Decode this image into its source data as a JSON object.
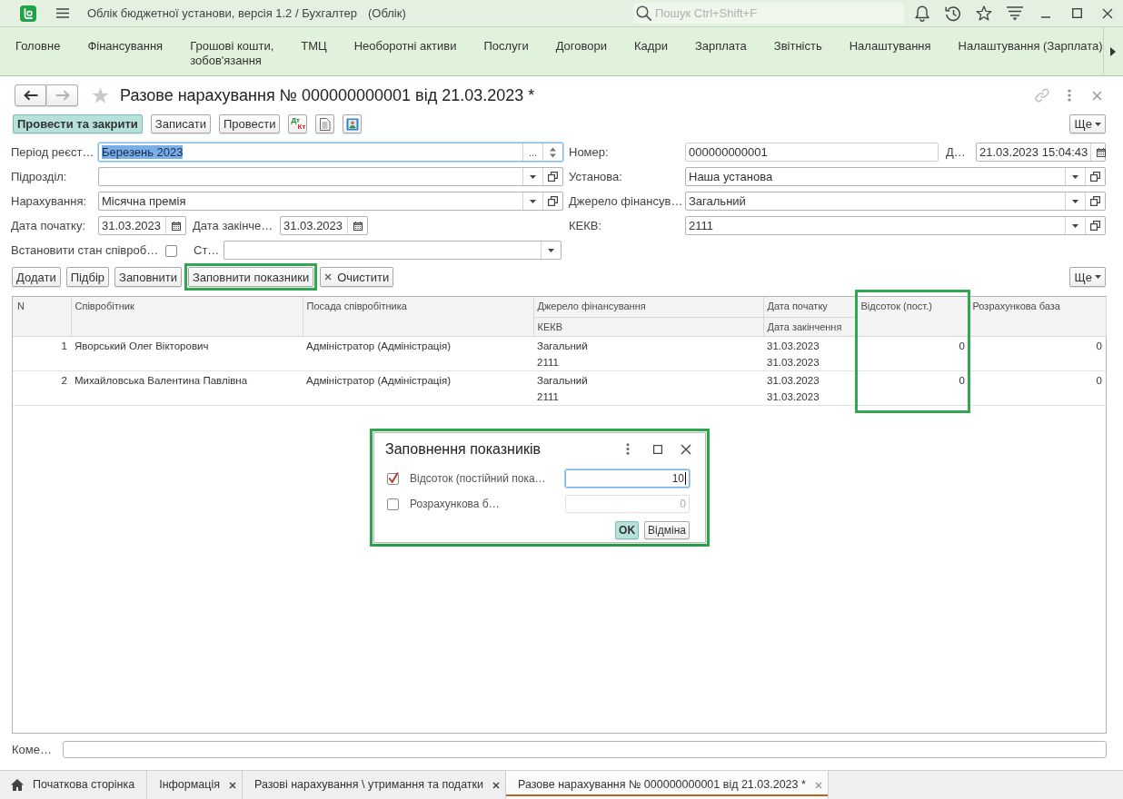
{
  "app_bar": {
    "title": "Облік бюджетної установи, версія 1.2 / Бухгалтер",
    "mode": "(Облік)",
    "search": {
      "placeholder": "Пошук Ctrl+Shift+F"
    }
  },
  "sections": [
    "Головне",
    "Фінансування",
    "Грошові кошти,\nзобов'язання",
    "ТМЦ",
    "Необоротні активи",
    "Послуги",
    "Договори",
    "Кадри",
    "Зарплата",
    "Звітність",
    "Налаштування",
    "Налаштування (Зарплата)"
  ],
  "document": {
    "navigation": [
      {
        "kind": "back",
        "disabled": false
      },
      {
        "kind": "forward",
        "disabled": true
      }
    ],
    "favorite": false,
    "title": "Разове нарахування № 000000000001 від 21.03.2023 *",
    "toolbar": [
      {
        "kind": "primary",
        "label": "Провести та закрити"
      },
      {
        "kind": "text",
        "label": "Записати"
      },
      {
        "kind": "text",
        "label": "Провести"
      },
      {
        "kind": "dtkt",
        "label": "Дт",
        "label_2": "Кт"
      },
      {
        "kind": "document"
      },
      {
        "kind": "report"
      }
    ],
    "more_label": "Ще",
    "left_fields": [
      {
        "kind": "period",
        "label": "Період реєст…",
        "value": "Березень 2023",
        "focused": true,
        "text_selected": true,
        "choice_button": "..."
      },
      {
        "kind": "select",
        "label": "Підрозділ:"
      },
      {
        "kind": "select",
        "label": "Нарахування:",
        "value": "Місячна премія"
      },
      {
        "kind": "date_pair",
        "label": "Дата початку:",
        "value": "31.03.2023",
        "label_2": "Дата закінче…",
        "value_2": "31.03.2023"
      },
      {
        "kind": "check_select",
        "label": "Встановити стан співроб…",
        "checked": false,
        "label_2": "Ст…"
      }
    ],
    "right_fields": [
      {
        "kind": "number_date",
        "label": "Номер:",
        "value": "000000000001",
        "label_2": "Д…",
        "value_2": "21.03.2023 15:04:43"
      },
      {
        "kind": "select",
        "label": "Установа:",
        "value": "Наша установа"
      },
      {
        "kind": "select",
        "label": "Джерело фінансув…",
        "value": "Загальний"
      },
      {
        "kind": "select",
        "label": "КЕКВ:",
        "value": "2111"
      }
    ],
    "table_toolbar": [
      {
        "kind": "text",
        "label": "Додати",
        "highlighted": false
      },
      {
        "kind": "text",
        "label": "Підбір",
        "highlighted": false
      },
      {
        "kind": "text",
        "label": "Заповнити",
        "highlighted": false
      },
      {
        "kind": "text",
        "label": "Заповнити показники",
        "highlighted": true
      },
      {
        "kind": "clear",
        "label": "Очистити",
        "highlighted": false
      }
    ],
    "table_more_label": "Ще",
    "table": {
      "columns": [
        {
          "label": "N",
          "kind": "number",
          "highlighted": false
        },
        {
          "label": "Співробітник",
          "kind": "text",
          "highlighted": false
        },
        {
          "label": "Посада співробітника",
          "kind": "text",
          "highlighted": false
        },
        {
          "label": "Джерело фінансування",
          "sublabel": "КЕКВ",
          "kind": "text",
          "highlighted": false
        },
        {
          "label": "Дата початку",
          "sublabel": "Дата закінчення",
          "kind": "text",
          "highlighted": false
        },
        {
          "label": "Відсоток (пост.)",
          "kind": "number",
          "highlighted": true
        },
        {
          "label": "Розрахункова база",
          "kind": "number",
          "highlighted": false
        }
      ],
      "rows": [
        {
          "cells": [
            [
              "1"
            ],
            [
              "Яворський Олег Вікторович"
            ],
            [
              "Адміністратор (Адміністрація)"
            ],
            [
              "Загальний",
              "2111"
            ],
            [
              "31.03.2023",
              "31.03.2023"
            ],
            [
              "0"
            ],
            [
              "0"
            ]
          ]
        },
        {
          "cells": [
            [
              "2"
            ],
            [
              "Михайловська Валентина Павлівна"
            ],
            [
              "Адміністратор (Адміністрація)"
            ],
            [
              "Загальний",
              "2111"
            ],
            [
              "31.03.2023",
              "31.03.2023"
            ],
            [
              "0"
            ],
            [
              "0"
            ]
          ]
        }
      ]
    },
    "comment": {
      "label": "Коме…"
    }
  },
  "dialog": {
    "title": "Заповнення показників",
    "highlighted": true,
    "rows": [
      {
        "label": "Відсоток (постійний пока…",
        "checked": true,
        "value": "10",
        "focused": true,
        "disabled": false
      },
      {
        "label": "Розрахункова б…",
        "checked": false,
        "value": "0",
        "focused": false,
        "disabled": true
      }
    ],
    "buttons": [
      {
        "label": "OK",
        "default": true
      },
      {
        "label": "Відміна",
        "default": false
      }
    ]
  },
  "open_tabs": [
    {
      "kind": "home",
      "label": "Початкова сторінка",
      "closable": false,
      "selected": false
    },
    {
      "kind": "page",
      "label": "Інформація",
      "closable": true,
      "selected": false
    },
    {
      "kind": "page",
      "label": "Разові нарахування \\ утримання та податки",
      "closable": true,
      "selected": false
    },
    {
      "kind": "page",
      "label": "Разове нарахування № 000000000001 від 21.03.2023 *",
      "closable": true,
      "selected": true
    }
  ]
}
